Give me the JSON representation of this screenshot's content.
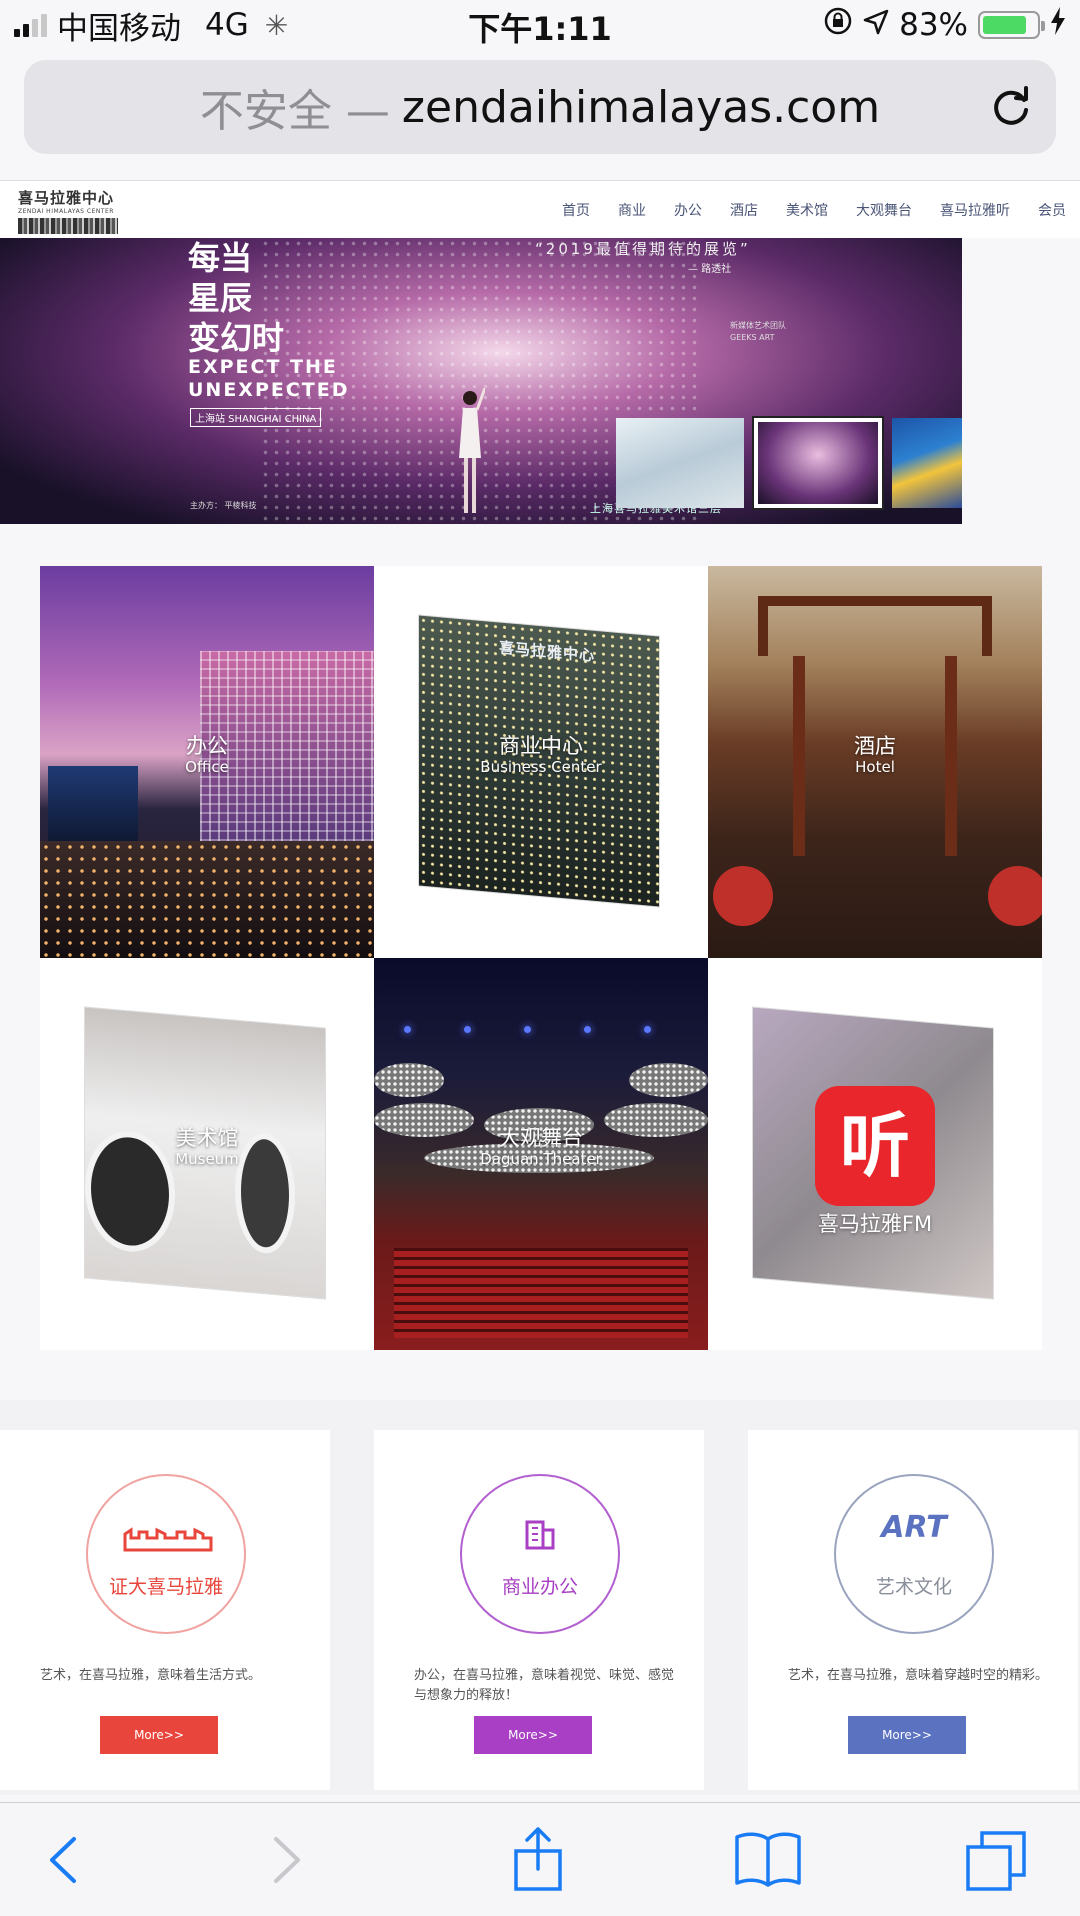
{
  "status_bar": {
    "carrier": "中国移动",
    "network": "4G",
    "time": "下午1:11",
    "battery_percent": "83%",
    "battery_level": 0.83
  },
  "url_bar": {
    "security_label": "不安全 —",
    "host": "zendaihimalayas.com"
  },
  "site": {
    "logo_text": "喜马拉雅中心",
    "logo_subtext": "ZENDAI HIMALAYAS CENTER",
    "nav": [
      "首页",
      "商业",
      "办公",
      "酒店",
      "美术馆",
      "大观舞台",
      "喜马拉雅听",
      "会员"
    ]
  },
  "hero": {
    "title_lines": [
      "每当",
      "星辰",
      "变幻时"
    ],
    "english_lines": [
      "EXPECT THE",
      "UNEXPECTED"
    ],
    "location": "上海站 SHANGHAI CHINA",
    "quote": "“2019最值得期待的展览”",
    "quote_source": "— 路透社",
    "partner": "新媒体艺术团队",
    "partner_name": "GEEKS ART",
    "venue": "上海喜马拉雅美术馆三层",
    "sponsor": "主办方： 平棱科技"
  },
  "tiles": [
    {
      "title": "办公",
      "subtitle": "Office"
    },
    {
      "title": "商业中心",
      "subtitle": "Business Center",
      "sign": "喜马拉雅中心"
    },
    {
      "title": "酒店",
      "subtitle": "Hotel"
    },
    {
      "title": "美术馆",
      "subtitle": "Museum"
    },
    {
      "title": "大观舞台",
      "subtitle": "Daguan Theater"
    },
    {
      "title": "",
      "subtitle": "",
      "fm_label": "喜马拉雅FM",
      "fm_glyph": "听"
    }
  ],
  "cards": [
    {
      "circle_label": "证大喜马拉雅",
      "text": "艺术，在喜马拉雅，意味着生活方式。",
      "button": "More>>",
      "color": "#e8463c",
      "icon": "skyline-icon"
    },
    {
      "circle_label": "商业办公",
      "text": "办公，在喜马拉雅，意味着视觉、味觉、感觉与想象力的释放！",
      "button": "More>>",
      "color": "#a93fc4",
      "icon": "building-icon"
    },
    {
      "circle_label": "艺术文化",
      "text": "艺术，在喜马拉雅，意味着穿越时空的精彩。",
      "button": "More>>",
      "color": "#5a72c0",
      "icon": "art-icon",
      "icon_text": "ART"
    }
  ],
  "toolbar": {
    "buttons": [
      "back-icon",
      "forward-icon",
      "share-icon",
      "bookmarks-icon",
      "tabs-icon"
    ]
  }
}
